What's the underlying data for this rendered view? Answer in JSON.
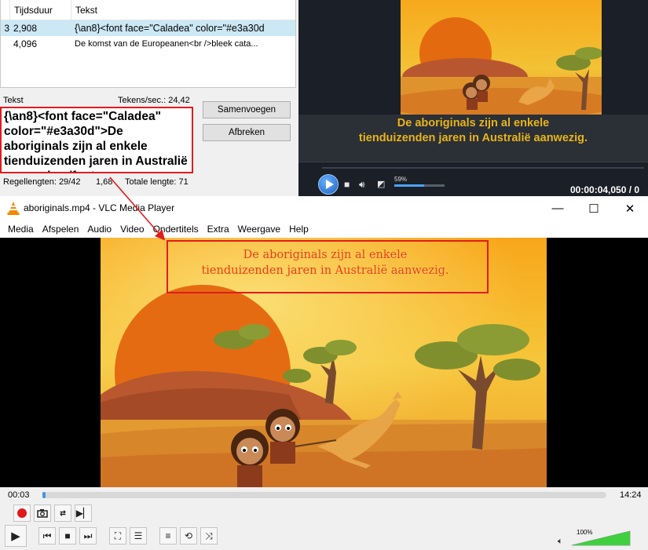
{
  "editor": {
    "columns": {
      "num": "",
      "duration": "Tijdsduur",
      "text": "Tekst"
    },
    "rows": [
      {
        "num": "3",
        "duration": "2,908",
        "text": "{\\an8}<font face=\"Caladea\" color=\"#e3a30d",
        "selected": true
      },
      {
        "num": "",
        "duration": "4,096",
        "text": "De komst van de Europeanen<br />bleek cata...",
        "selected": false
      }
    ],
    "text_label": "Tekst",
    "chars_per_sec": "Tekens/sec.: 24,42",
    "text_value": "{\\an8}<font face=\"Caladea\" color=\"#e3a30d\">De aboriginals zijn al enkele tienduizenden jaren in",
    "text_value_cut": "Australië aanwezig.</font>",
    "merge_button": "Samenvoegen",
    "split_button": "Afbreken",
    "line_lengths": "Regellengten: 29/42",
    "duration_ratio": "1,68",
    "total_length": "Totale lengte: 71"
  },
  "preview": {
    "subtitle_line1": "De aboriginals zijn al enkele",
    "subtitle_line2": "tienduizenden jaren in Australië aanwezig.",
    "volume": "59%",
    "volume_fraction": 0.59,
    "time": "00:00:04,050 / 0"
  },
  "vlc": {
    "title": "aboriginals.mp4 - VLC Media Player",
    "window_controls": {
      "minimize": "—",
      "maximize": "☐",
      "close": "✕"
    },
    "menu": [
      "Media",
      "Afspelen",
      "Audio",
      "Video",
      "Ondertitels",
      "Extra",
      "Weergave",
      "Help"
    ],
    "subtitle_line1": "De aboriginals zijn al enkele",
    "subtitle_line2": "tienduizenden jaren in Australië aanwezig.",
    "elapsed": "00:03",
    "total": "14:24",
    "seek_fraction": 0.004,
    "volume": "100%",
    "volume_fraction": 1.0,
    "icons": {
      "record": "record-icon",
      "snapshot": "camera-icon",
      "loop_ab": "ab-loop-icon",
      "frame_step": "frame-step-icon",
      "play": "play-icon",
      "prev": "previous-icon",
      "stop": "stop-icon",
      "next": "next-icon",
      "fullscreen": "fullscreen-icon",
      "extended": "equalizer-icon",
      "playlist": "playlist-icon",
      "loop": "loop-icon",
      "shuffle": "shuffle-icon",
      "volume": "speaker-icon"
    }
  },
  "colors": {
    "callout": "#e11c1c",
    "subtitle_font_color": "#e3a30d",
    "accent": "#4a90e2"
  }
}
